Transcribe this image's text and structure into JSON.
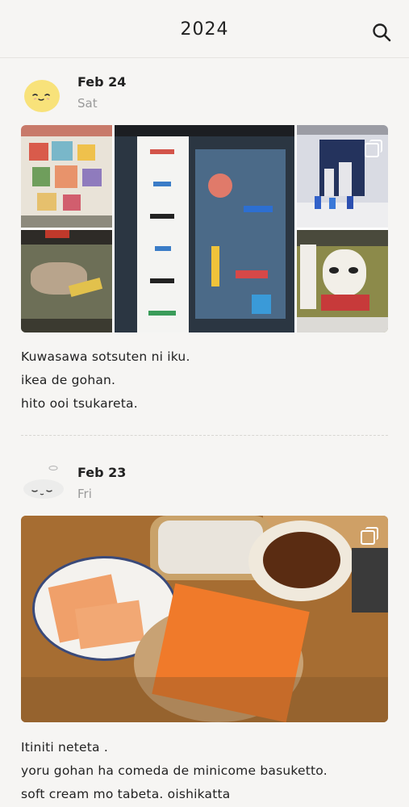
{
  "header": {
    "title": "2024",
    "search_icon": "search-icon"
  },
  "entries": [
    {
      "date": "Feb 24",
      "weekday": "Sat",
      "avatar": "yellow-blob-face",
      "photo_count_icon": "multiple-photos-icon",
      "text_lines": [
        "Kuwasawa sotsuten ni iku.",
        "ikea de gohan.",
        "hito ooi tsukareta."
      ]
    },
    {
      "date": "Feb 23",
      "weekday": "Fri",
      "avatar": "white-sleeping-blob",
      "photo_count_icon": "multiple-photos-icon",
      "text_lines": [
        "Itiniti neteta .",
        "yoru gohan ha comeda de minicome basuketto.",
        "soft cream mo tabeta. oishikatta"
      ]
    }
  ],
  "colors": {
    "background": "#f6f5f3",
    "divider": "#d8d6d2",
    "weekday": "#9a9a9a"
  }
}
